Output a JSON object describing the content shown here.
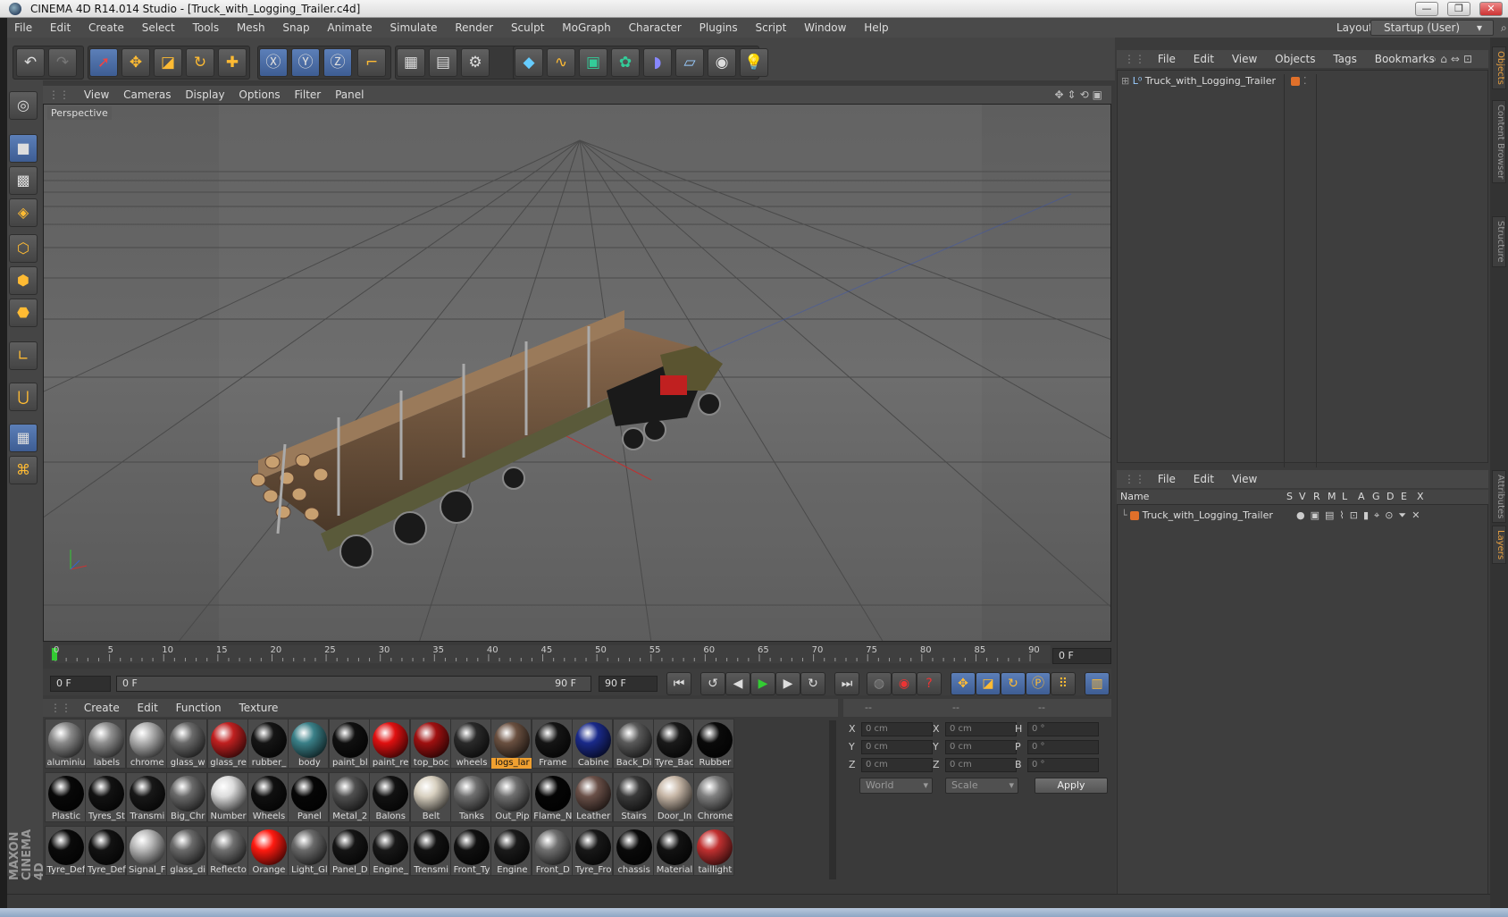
{
  "window": {
    "title": "CINEMA 4D R14.014 Studio - [Truck_with_Logging_Trailer.c4d]",
    "min": "—",
    "max": "❐",
    "close": "✕"
  },
  "menubar": {
    "items": [
      "File",
      "Edit",
      "Create",
      "Select",
      "Tools",
      "Mesh",
      "Snap",
      "Animate",
      "Simulate",
      "Render",
      "Sculpt",
      "MoGraph",
      "Character",
      "Plugins",
      "Script",
      "Window",
      "Help"
    ],
    "layout_label": "Layout:",
    "layout_value": "Startup (User)"
  },
  "viewport": {
    "menu": [
      "View",
      "Cameras",
      "Display",
      "Options",
      "Filter",
      "Panel"
    ],
    "label": "Perspective"
  },
  "timeline": {
    "ticks": [
      "0",
      "5",
      "10",
      "15",
      "20",
      "25",
      "30",
      "35",
      "40",
      "45",
      "50",
      "55",
      "60",
      "65",
      "70",
      "75",
      "80",
      "85",
      "90"
    ],
    "current_frame": "0 F",
    "start_field": "0 F",
    "range_start": "0 F",
    "range_end": "90 F",
    "end_field": "90 F"
  },
  "materials": {
    "menu": [
      "Create",
      "Edit",
      "Function",
      "Texture"
    ],
    "rows": [
      [
        {
          "n": "aluminiu",
          "c": "#8a8a8a"
        },
        {
          "n": "labels",
          "c": "#909090"
        },
        {
          "n": "chrome",
          "c": "#b0b0b0"
        },
        {
          "n": "glass_w",
          "c": "#6a6a6a"
        },
        {
          "n": "glass_re",
          "c": "#c02020"
        },
        {
          "n": "rubber_",
          "c": "#151515"
        },
        {
          "n": "body",
          "c": "#3a8088"
        },
        {
          "n": "paint_bl",
          "c": "#101010"
        },
        {
          "n": "paint_re",
          "c": "#e01010"
        },
        {
          "n": "top_boc",
          "c": "#a01010"
        },
        {
          "n": "wheels",
          "c": "#2a2a2a"
        },
        {
          "n": "logs_lar",
          "c": "#6a5040",
          "sel": true
        },
        {
          "n": "Frame",
          "c": "#151515"
        },
        {
          "n": "Cabine",
          "c": "#1a2a8a"
        },
        {
          "n": "Back_Di",
          "c": "#5a5a5a"
        },
        {
          "n": "Tyre_Bac",
          "c": "#1a1a1a"
        },
        {
          "n": "Rubber",
          "c": "#0a0a0a"
        }
      ],
      [
        {
          "n": "Plastic",
          "c": "#080808"
        },
        {
          "n": "Tyres_St",
          "c": "#121212"
        },
        {
          "n": "Transmi",
          "c": "#181818"
        },
        {
          "n": "Big_Chr",
          "c": "#6a6a6a"
        },
        {
          "n": "Number",
          "c": "#dcdcdc"
        },
        {
          "n": "Wheels",
          "c": "#101010"
        },
        {
          "n": "Panel",
          "c": "#060606"
        },
        {
          "n": "Metal_2",
          "c": "#505050"
        },
        {
          "n": "Balons",
          "c": "#121212"
        },
        {
          "n": "Belt",
          "c": "#d8d0c0"
        },
        {
          "n": "Tanks",
          "c": "#707070"
        },
        {
          "n": "Out_Pip",
          "c": "#707070"
        },
        {
          "n": "Flame_N",
          "c": "#050505"
        },
        {
          "n": "Leather",
          "c": "#6a5048"
        },
        {
          "n": "Stairs",
          "c": "#3a3a3a"
        },
        {
          "n": "Door_In",
          "c": "#c8b8a8"
        },
        {
          "n": "Chrome",
          "c": "#808080"
        }
      ],
      [
        {
          "n": "Tyre_Def",
          "c": "#0a0a0a"
        },
        {
          "n": "Tyre_Def",
          "c": "#121212"
        },
        {
          "n": "Signal_F",
          "c": "#b8b8b8"
        },
        {
          "n": "glass_di",
          "c": "#6a6a6a"
        },
        {
          "n": "Reflecto",
          "c": "#707070"
        },
        {
          "n": "Orange",
          "c": "#ff1a10"
        },
        {
          "n": "Light_Gl",
          "c": "#6a6a6a"
        },
        {
          "n": "Panel_D",
          "c": "#151515"
        },
        {
          "n": "Engine_",
          "c": "#181818"
        },
        {
          "n": "Trensmi",
          "c": "#121212"
        },
        {
          "n": "Front_Ty",
          "c": "#101010"
        },
        {
          "n": "Engine",
          "c": "#1a1a1a"
        },
        {
          "n": "Front_D",
          "c": "#707070"
        },
        {
          "n": "Tyre_Fro",
          "c": "#181818"
        },
        {
          "n": "chassis",
          "c": "#0a0a0a"
        },
        {
          "n": "Material",
          "c": "#121212"
        },
        {
          "n": "taillight",
          "c": "#c03030"
        }
      ]
    ]
  },
  "coordinates": {
    "header": [
      "--",
      "--",
      "--"
    ],
    "rows": [
      {
        "a": "X",
        "av": "0 cm",
        "b": "X",
        "bv": "0 cm",
        "c": "H",
        "cv": "0 °"
      },
      {
        "a": "Y",
        "av": "0 cm",
        "b": "Y",
        "bv": "0 cm",
        "c": "P",
        "cv": "0 °"
      },
      {
        "a": "Z",
        "av": "0 cm",
        "b": "Z",
        "bv": "0 cm",
        "c": "B",
        "cv": "0 °"
      }
    ],
    "space": "World",
    "mode": "Scale",
    "apply": "Apply"
  },
  "objects": {
    "menu": [
      "File",
      "Edit",
      "View",
      "Objects",
      "Tags",
      "Bookmarks"
    ],
    "item": "Truck_with_Logging_Trailer"
  },
  "layers": {
    "menu": [
      "File",
      "Edit",
      "View"
    ],
    "columns": [
      "Name",
      "S",
      "V",
      "R",
      "M",
      "L",
      "A",
      "G",
      "D",
      "E",
      "X"
    ],
    "item": "Truck_with_Logging_Trailer"
  },
  "sidetabs": [
    "Objects",
    "Content Browser",
    "Structure",
    "Attributes",
    "Layers"
  ],
  "brand": "MAXON CINEMA 4D"
}
